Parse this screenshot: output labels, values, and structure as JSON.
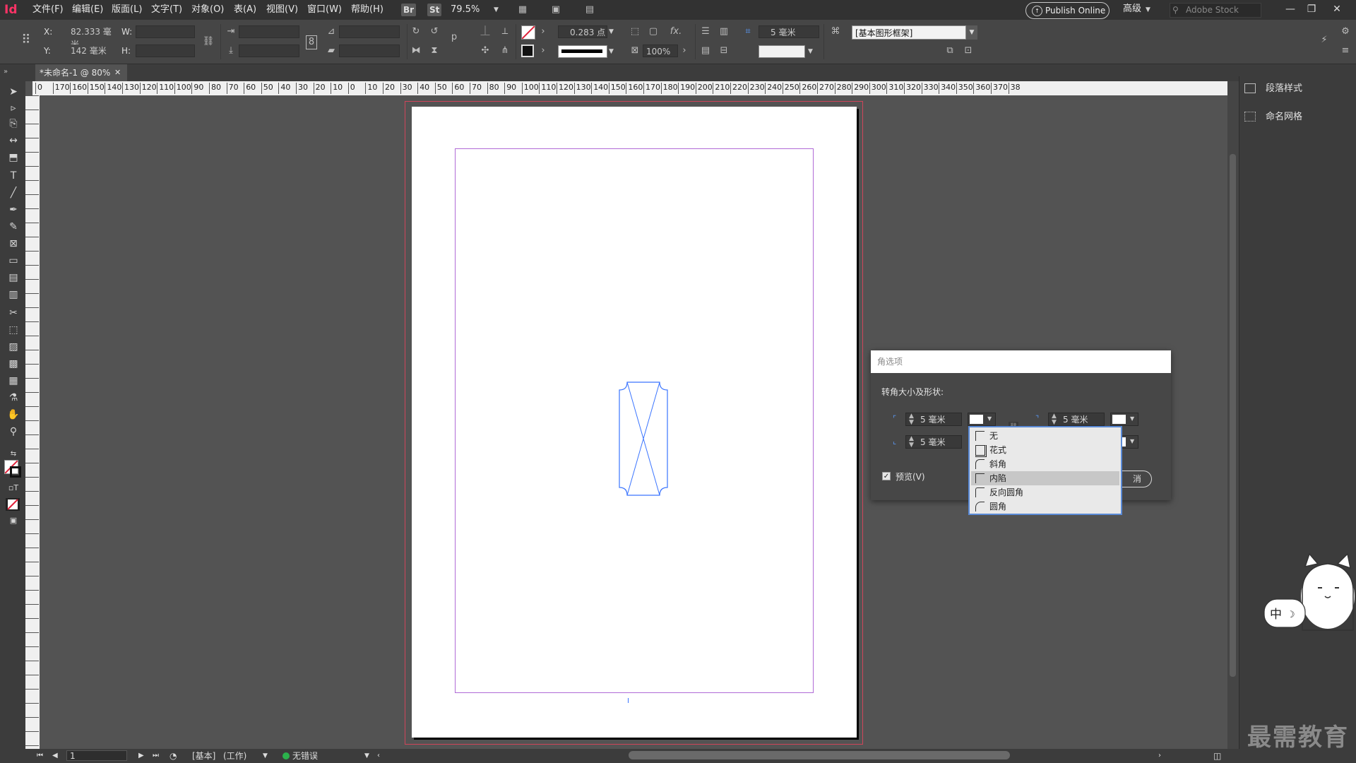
{
  "menubar": {
    "logo": "Id",
    "items": [
      "文件(F)",
      "编辑(E)",
      "版面(L)",
      "文字(T)",
      "对象(O)",
      "表(A)",
      "视图(V)",
      "窗口(W)",
      "帮助(H)"
    ],
    "bridge_chip": "Br",
    "stock_chip": "St",
    "zoom": "79.5%",
    "publish_label": "Publish Online",
    "workspace": "高级",
    "search_placeholder": "Adobe Stock",
    "window_buttons": [
      "—",
      "❐",
      "✕"
    ]
  },
  "controlbar": {
    "x_label": "X:",
    "x_value": "82.333 毫米",
    "y_label": "Y:",
    "y_value": "142 毫米",
    "w_label": "W:",
    "h_label": "H:",
    "stroke_weight": "0.283 点",
    "opacity": "100%",
    "corner_size": "5 毫米",
    "object_style": "[基本图形框架]"
  },
  "tabbar": {
    "doc_tab": "*未命名-1 @ 80%"
  },
  "ruler": {
    "h_labels": [
      "0",
      "170",
      "160",
      "150",
      "140",
      "130",
      "120",
      "110",
      "100",
      "90",
      "80",
      "70",
      "60",
      "50",
      "40",
      "30",
      "20",
      "10",
      "0",
      "10",
      "20",
      "30",
      "40",
      "50",
      "60",
      "70",
      "80",
      "90",
      "100",
      "110",
      "120",
      "130",
      "140",
      "150",
      "160",
      "170",
      "180",
      "190",
      "200",
      "210",
      "220",
      "230",
      "240",
      "250",
      "260",
      "270",
      "280",
      "290",
      "300",
      "310",
      "320",
      "330",
      "340",
      "350",
      "360",
      "370",
      "38"
    ]
  },
  "panels": {
    "items": [
      "段落样式",
      "命名网格"
    ]
  },
  "dialog": {
    "title": "角选项",
    "section_label": "转角大小及形状:",
    "top_left_size": "5 毫米",
    "top_right_size": "5 毫米",
    "bottom_left_size": "5 毫米",
    "preview_label": "预览(V)",
    "cancel_label": "消",
    "checkbox_mark": "✓"
  },
  "dropdown": {
    "options": [
      "无",
      "花式",
      "斜角",
      "内陷",
      "反向圆角",
      "圆角"
    ],
    "selected": "内陷"
  },
  "statusbar": {
    "page_number": "1",
    "master": "[基本]",
    "mode": "(工作)",
    "preflight": "无错误"
  },
  "mascot": {
    "ime_label": "中"
  },
  "watermark": "最需教育",
  "colors": {
    "accent_pink": "#ff3366",
    "bleed_red": "#d0455a",
    "margin_purple": "#b06ad6",
    "frame_blue": "#3a74ff",
    "status_green": "#2bb24c"
  }
}
